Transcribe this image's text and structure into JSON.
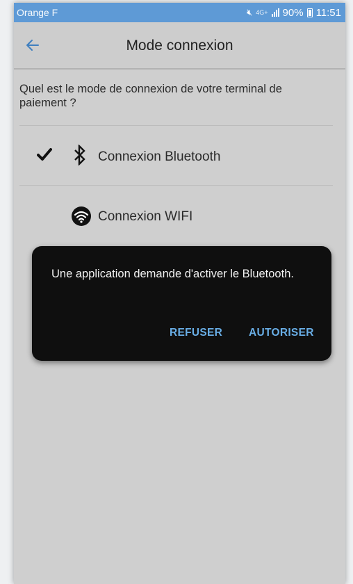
{
  "status_bar": {
    "carrier": "Orange F",
    "network": "4G+",
    "battery": "90%",
    "time": "11:51",
    "icons": [
      "mute-icon",
      "signal-icon",
      "battery-icon"
    ]
  },
  "app_bar": {
    "title": "Mode connexion",
    "back_icon": "arrow-left-icon"
  },
  "question": "Quel est le mode de connexion de votre terminal de paiement ?",
  "options": [
    {
      "label": "Connexion Bluetooth",
      "icon": "bluetooth-icon",
      "selected": true
    },
    {
      "label": "Connexion WIFI",
      "icon": "wifi-icon",
      "selected": false
    }
  ],
  "dialog": {
    "message": "Une application demande d'activer le Bluetooth.",
    "refuse_label": "REFUSER",
    "allow_label": "AUTORISER"
  },
  "colors": {
    "status_bar": "#5e9ad6",
    "accent": "#3f7fbf",
    "dialog_bg": "#0f0f0f",
    "dialog_button": "#69aee6",
    "screen_overlay": "#cfcfcf"
  }
}
